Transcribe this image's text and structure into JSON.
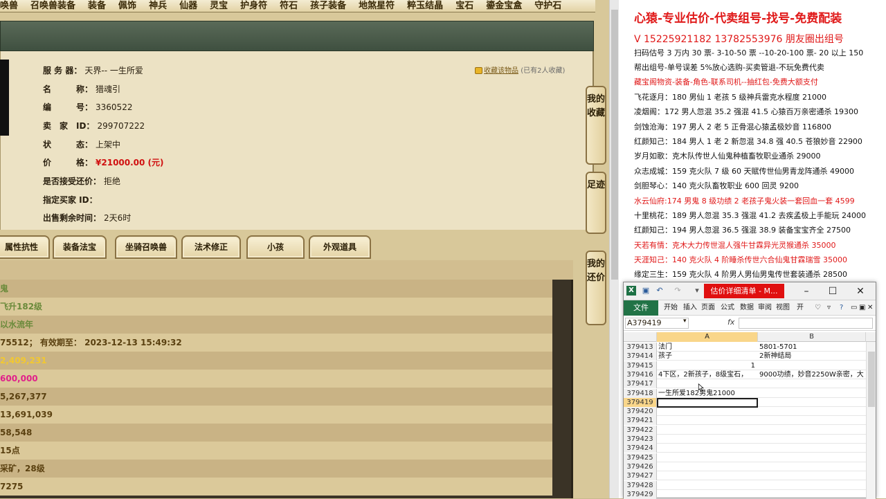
{
  "nav": {
    "items": [
      "唤兽",
      "召唤兽装备",
      "装备",
      "佩饰",
      "神兵",
      "仙器",
      "灵宝",
      "护身符",
      "符石",
      "孩子装备",
      "地煞星符",
      "粹玉结晶",
      "宝石",
      "鎏金宝盒",
      "守护石"
    ]
  },
  "detail": {
    "server_label": "服 务 器：",
    "server_value": "天界-- 一生所爱",
    "name_label": "名　　　称：",
    "name_value": "猎魂引",
    "id_label": "编　　　号：",
    "id_value": "3360522",
    "seller_label": "卖　家　ID：",
    "seller_value": "299707222",
    "status_label": "状　　　态：",
    "status_value": "上架中",
    "price_label": "价　　　格：",
    "price_value": "¥21000.00 (元)",
    "bargain_label": "是否接受还价：",
    "bargain_value": "拒绝",
    "buyer_label": "指定买家 ID：",
    "buyer_value": "",
    "remain_label": "出售剩余时间：",
    "remain_value": "2天6时",
    "fav_link": "收藏该物品",
    "fav_count": "(已有2人收藏)"
  },
  "tabs": [
    "属性抗性",
    "装备法宝",
    "坐骑召唤兽",
    "法术修正",
    "小孩",
    "外观道具"
  ],
  "rows": [
    {
      "text": "鬼",
      "color": "#6a8a3a"
    },
    {
      "text": "飞升182级",
      "color": "#6a8a3a"
    },
    {
      "text": "以水流年",
      "color": "#6a8a3a"
    },
    {
      "text": "75512； 有效期至： 2023-12-13 15:49:32",
      "color": "#5a4010"
    },
    {
      "text": "2,409,231",
      "color": "#f2c830"
    },
    {
      "text": "600,000",
      "color": "#e0208a"
    },
    {
      "text": "5,267,377",
      "color": "#5a4010"
    },
    {
      "text": "13,691,039",
      "color": "#5a4010"
    },
    {
      "text": "58,548",
      "color": "#5a4010"
    },
    {
      "text": "15点",
      "color": "#5a4010"
    },
    {
      "text": "采矿，28级",
      "color": "#5a4010"
    },
    {
      "text": "7275",
      "color": "#5a4010"
    }
  ],
  "sidetabs": [
    "我的收藏",
    "足迹",
    "我的还价"
  ],
  "ads": [
    {
      "text": "心猿-专业估价-代卖组号-找号-免费配装",
      "style": "big"
    },
    {
      "text": "V 15225921182   13782553976 朋友圈出组号",
      "style": "mid"
    },
    {
      "text": "扫码估号 3 万内 30 票- 3-10-50 票  --10-20-100 票- 20 以上 150",
      "style": "normal"
    },
    {
      "text": "帮出组号-单号误差 5%放心选购-买卖管退-不玩免费代卖",
      "style": "normal"
    },
    {
      "text": "藏宝阁物资-装备-角色-联系司机--抽红包-免费大额支付",
      "style": "red"
    },
    {
      "text": "飞花逐月：180 男仙 1 老孩 5 级神兵雷克水程度 21000",
      "style": "normal"
    },
    {
      "text": "凌烟阁：172 男人忽混 35.2 强混 41.5 心猿百万亲密通杀 19300",
      "style": "normal"
    },
    {
      "text": "剑蚀沧海：197 男人 2 老 5 正骨混心猿孟极妙音 116800",
      "style": "normal"
    },
    {
      "text": "红颜知己：184 男人 1 老 2 新忽混 34.8 强 40.5 苍狼妙音 22900",
      "style": "normal"
    },
    {
      "text": "岁月如歌：克木队传世人仙鬼种植畜牧职业通杀 29000",
      "style": "normal"
    },
    {
      "text": "众志成城：159 克火队 7 级 60 天赋传世仙男青龙阵通杀 49000",
      "style": "normal"
    },
    {
      "text": "剑胆琴心：140 克火队畜牧职业 600 回灵 9200",
      "style": "normal"
    },
    {
      "text": "水云仙府:174 男鬼 8 级功绩 2 老孩子鬼火装一套回血一套 4599",
      "style": "red"
    },
    {
      "text": "十里桃花：189 男人忽混 35.3 强混 41.2 去疾孟极上手能玩 24000",
      "style": "normal"
    },
    {
      "text": "红颜知己：194 男人忽混 36.5 强混 38.9 装备宝宝齐全 27500",
      "style": "normal"
    },
    {
      "text": "天若有情：克木大力传世混人强牛甘霖异光灵猴通杀 35000",
      "style": "red"
    },
    {
      "text": "天涯知己：140 克火队 4 阶睡杀传世六合仙鬼甘霖瑞雪 35000",
      "style": "red"
    },
    {
      "text": "缘定三生：159 克火队 4 阶男人男仙男鬼传世套装通杀 28500",
      "style": "normal"
    }
  ],
  "excel": {
    "title": "估价详细清单 - M...",
    "file_tab": "文件",
    "ribbon": [
      "开始",
      "插入",
      "页面",
      "公式",
      "数据",
      "审阅",
      "视图",
      "开"
    ],
    "namebox": "A379419",
    "fx": "fx",
    "col_a": "A",
    "col_b": "B",
    "rows": [
      {
        "n": "379413",
        "a": "法门",
        "b": "5801-5701"
      },
      {
        "n": "379414",
        "a": "孩子",
        "b": "2新神结局"
      },
      {
        "n": "379415",
        "a": "1",
        "b": "",
        "num": true
      },
      {
        "n": "379416",
        "a": "4下区，2新孩子，8级宝石，",
        "b": "9000功绩，妙音2250W亲密，大"
      },
      {
        "n": "379417",
        "a": "",
        "b": ""
      },
      {
        "n": "379418",
        "a": "一生所爱182男鬼21000",
        "b": ""
      },
      {
        "n": "379419",
        "a": "",
        "b": "",
        "sel": true
      },
      {
        "n": "379420",
        "a": "",
        "b": ""
      },
      {
        "n": "379421",
        "a": "",
        "b": ""
      },
      {
        "n": "379422",
        "a": "",
        "b": ""
      },
      {
        "n": "379423",
        "a": "",
        "b": ""
      },
      {
        "n": "379424",
        "a": "",
        "b": ""
      },
      {
        "n": "379425",
        "a": "",
        "b": ""
      },
      {
        "n": "379426",
        "a": "",
        "b": ""
      },
      {
        "n": "379427",
        "a": "",
        "b": ""
      },
      {
        "n": "379428",
        "a": "",
        "b": ""
      },
      {
        "n": "379429",
        "a": "",
        "b": ""
      }
    ]
  }
}
